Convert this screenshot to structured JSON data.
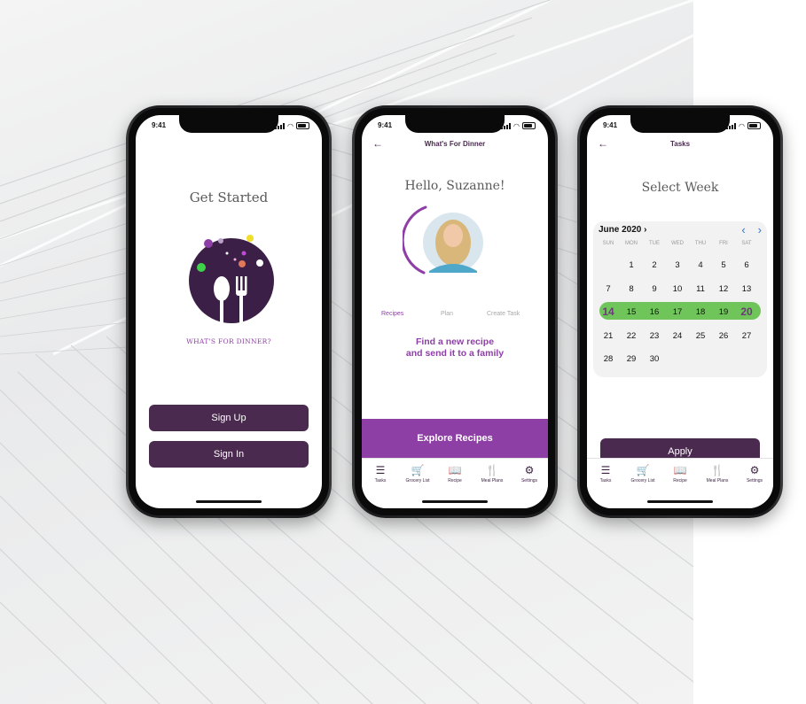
{
  "phones": {
    "p1": {
      "time": "9:41",
      "title": "Get Started",
      "logo_text": "WHAT'S FOR DINNER?",
      "signup_label": "Sign Up",
      "signin_label": "Sign In"
    },
    "p2": {
      "time": "9:41",
      "back_glyph": "←",
      "header_title": "What's For Dinner",
      "greeting": "Hello, Suzanne!",
      "tabs": [
        "Recipes",
        "Plan",
        "Create Task"
      ],
      "prompt_line1": "Find a new recipe",
      "prompt_line2": "and  send it to a family",
      "cta_label": "Explore Recipes"
    },
    "p3": {
      "time": "9:41",
      "back_glyph": "←",
      "header_title": "Tasks",
      "title": "Select Week",
      "month": "June 2020",
      "month_chevron": "›",
      "prev_glyph": "‹",
      "next_glyph": "›",
      "dow": [
        "SUN",
        "MON",
        "TUE",
        "WED",
        "THU",
        "FRI",
        "SAT"
      ],
      "weeks": [
        [
          "",
          "1",
          "2",
          "3",
          "4",
          "5",
          "6"
        ],
        [
          "7",
          "8",
          "9",
          "10",
          "11",
          "12",
          "13"
        ],
        [
          "14",
          "15",
          "16",
          "17",
          "18",
          "19",
          "20"
        ],
        [
          "21",
          "22",
          "23",
          "24",
          "25",
          "26",
          "27"
        ],
        [
          "28",
          "29",
          "30",
          "",
          "",
          "",
          ""
        ]
      ],
      "apply_label": "Apply"
    }
  },
  "tabbar": {
    "items": [
      {
        "label": "Tasks",
        "icon": "tasks-icon",
        "glyph": "☰"
      },
      {
        "label": "Grocery List",
        "icon": "cart-icon",
        "glyph": "🛒"
      },
      {
        "label": "Recipe",
        "icon": "book-icon",
        "glyph": "📖"
      },
      {
        "label": "Meal Plans",
        "icon": "utensils-icon",
        "glyph": "🍴"
      },
      {
        "label": "Settings",
        "icon": "gear-icon",
        "glyph": "⚙"
      }
    ]
  },
  "colors": {
    "brand": "#4b2a4f",
    "accent": "#8e3fa6",
    "highlight": "#6fc55a",
    "link_blue": "#2f6fd6"
  }
}
